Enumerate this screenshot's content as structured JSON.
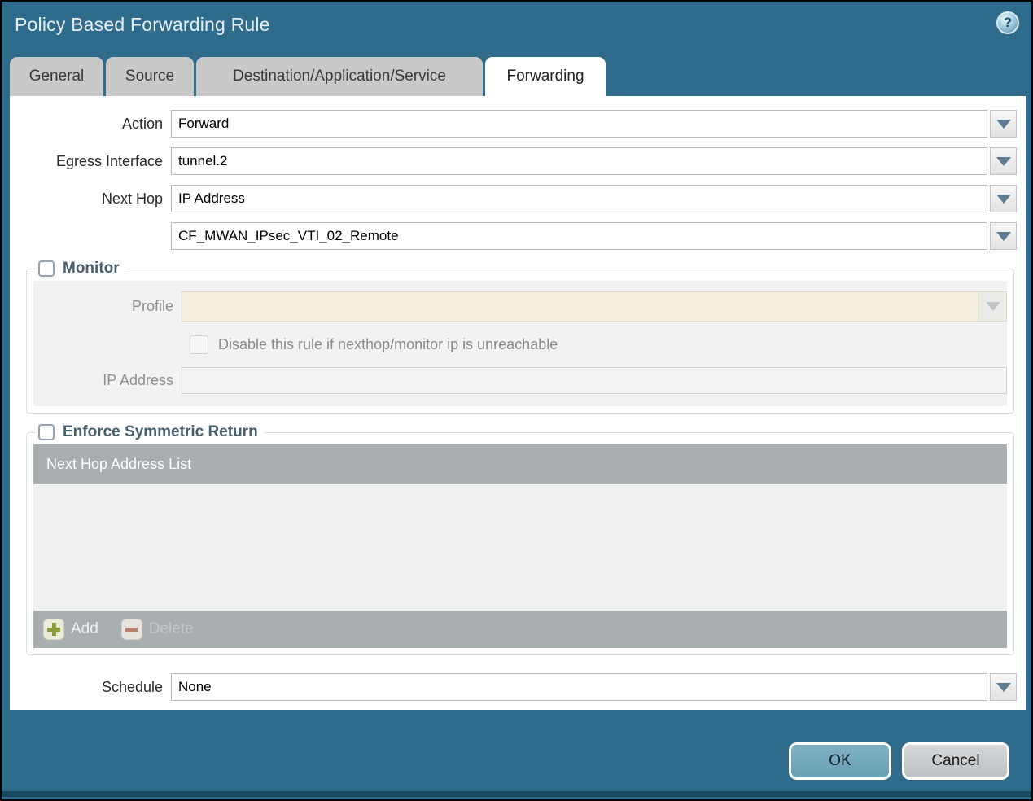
{
  "dialog": {
    "title": "Policy Based Forwarding Rule",
    "help_glyph": "?"
  },
  "tabs": [
    {
      "label": "General",
      "active": false
    },
    {
      "label": "Source",
      "active": false
    },
    {
      "label": "Destination/Application/Service",
      "active": false
    },
    {
      "label": "Forwarding",
      "active": true
    }
  ],
  "form": {
    "action": {
      "label": "Action",
      "value": "Forward"
    },
    "egress_interface": {
      "label": "Egress Interface",
      "value": "tunnel.2"
    },
    "next_hop": {
      "label": "Next Hop",
      "value": "IP Address"
    },
    "next_hop_address": {
      "value": "CF_MWAN_IPsec_VTI_02_Remote"
    },
    "schedule": {
      "label": "Schedule",
      "value": "None"
    }
  },
  "monitor": {
    "label": "Monitor",
    "checked": false,
    "profile": {
      "label": "Profile",
      "value": ""
    },
    "disable_rule": {
      "label": "Disable this rule if nexthop/monitor ip is unreachable",
      "checked": false
    },
    "ip_address": {
      "label": "IP Address",
      "value": ""
    }
  },
  "symmetric_return": {
    "label": "Enforce Symmetric Return",
    "checked": false,
    "table": {
      "header": "Next Hop Address List",
      "rows": []
    },
    "add_label": "Add",
    "delete_label": "Delete"
  },
  "footer": {
    "ok_label": "OK",
    "cancel_label": "Cancel"
  },
  "colors": {
    "titlebar_bg": "#2f6c8b",
    "active_tab_bg": "#ffffff",
    "inactive_tab_bg": "#c9c9c9",
    "section_label": "#47606e",
    "disabled_field_bg": "#f5eedd",
    "table_bar_bg": "#a9aeb1",
    "ok_button_bg": "#72a7bb",
    "cancel_button_bg": "#c8cbcd",
    "add_icon": "#8a9b3e",
    "delete_icon": "#b5826f"
  }
}
